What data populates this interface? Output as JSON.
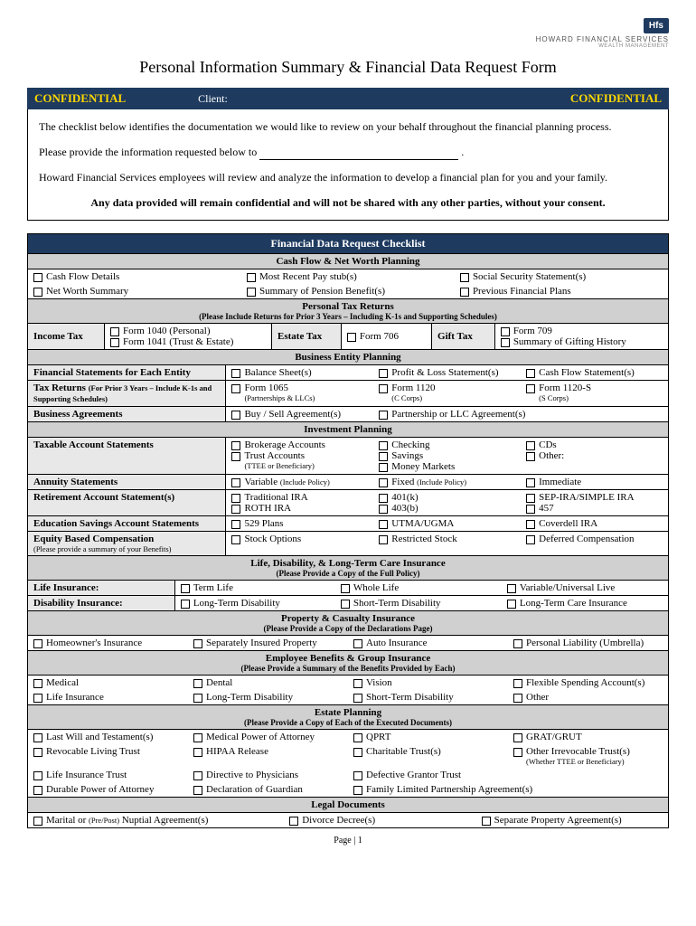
{
  "logo": {
    "badge": "Hfs",
    "company": "HOWARD FINANCIAL SERVICES",
    "tagline": "WEALTH MANAGEMENT"
  },
  "title": "Personal Information Summary & Financial Data Request Form",
  "conf": {
    "left": "CONFIDENTIAL",
    "client_label": "Client:",
    "right": "CONFIDENTIAL"
  },
  "intro": {
    "p1": "The checklist below identifies the documentation we would like to review on your behalf throughout the financial planning process.",
    "p2a": "Please provide the information requested below to",
    "p2b": ".",
    "p3": "Howard Financial Services employees will review and analyze the information to develop a financial plan for you and your family.",
    "p4": "Any data provided will remain confidential and will not be shared with any other parties, without your consent."
  },
  "checklist_title": "Financial Data Request Checklist",
  "sections": {
    "cashflow": {
      "header": "Cash Flow & Net Worth Planning",
      "r1": [
        "Cash Flow Details",
        "Most Recent Pay stub(s)",
        "Social Security Statement(s)"
      ],
      "r2": [
        "Net Worth Summary",
        "Summary of Pension Benefit(s)",
        "Previous Financial Plans"
      ]
    },
    "tax": {
      "header": "Personal Tax Returns",
      "sub": "(Please Include Returns for Prior 3 Years – Including K-1s and Supporting Schedules)",
      "income_label": "Income Tax",
      "income": [
        "Form 1040 (Personal)",
        "Form 1041 (Trust & Estate)"
      ],
      "estate_label": "Estate Tax",
      "estate": "Form 706",
      "gift_label": "Gift Tax",
      "gift": [
        "Form 709",
        "Summary of Gifting History"
      ]
    },
    "business": {
      "header": "Business Entity Planning",
      "r1_label": "Financial Statements for Each Entity",
      "r1": [
        "Balance Sheet(s)",
        "Profit & Loss Statement(s)",
        "Cash Flow Statement(s)"
      ],
      "r2_label": "Tax Returns",
      "r2_note": "(For Prior 3 Years – Include K-1s and Supporting Schedules)",
      "r2a": "Form 1065",
      "r2a_note": "(Partnerships & LLCs)",
      "r2b": "Form 1120",
      "r2b_note": "(C Corps)",
      "r2c": "Form 1120-S",
      "r2c_note": "(S Corps)",
      "r3_label": "Business Agreements",
      "r3": [
        "Buy / Sell Agreement(s)",
        "Partnership or LLC Agreement(s)"
      ]
    },
    "invest": {
      "header": "Investment Planning",
      "r1_label": "Taxable Account Statements",
      "r1c1": [
        "Brokerage Accounts",
        "Trust Accounts"
      ],
      "r1c1_note": "(TTEE or Beneficiary)",
      "r1c2": [
        "Checking",
        "Savings",
        "Money Markets"
      ],
      "r1c3": [
        "CDs",
        "Other:"
      ],
      "r2_label": "Annuity Statements",
      "r2": [
        "Variable",
        "Fixed",
        "Immediate"
      ],
      "r2_note": "(Include Policy)",
      "r3_label": "Retirement Account Statement(s)",
      "r3c1": [
        "Traditional IRA",
        "ROTH IRA"
      ],
      "r3c2": [
        "401(k)",
        "403(b)"
      ],
      "r3c3": [
        "SEP-IRA/SIMPLE IRA",
        "457"
      ],
      "r4_label": "Education Savings Account Statements",
      "r4": [
        "529 Plans",
        "UTMA/UGMA",
        "Coverdell IRA"
      ],
      "r5_label": "Equity Based Compensation",
      "r5_note": "(Please provide a summary of your Benefits)",
      "r5": [
        "Stock Options",
        "Restricted Stock",
        "Deferred Compensation"
      ]
    },
    "life": {
      "header": "Life, Disability, & Long-Term Care Insurance",
      "sub": "(Please Provide a Copy of the Full Policy)",
      "r1_label": "Life Insurance:",
      "r1": [
        "Term Life",
        "Whole Life",
        "Variable/Universal Live"
      ],
      "r2_label": "Disability Insurance:",
      "r2": [
        "Long-Term Disability",
        "Short-Term Disability",
        "Long-Term Care Insurance"
      ]
    },
    "property": {
      "header": "Property & Casualty Insurance",
      "sub": "(Please Provide a Copy of the Declarations Page)",
      "r1": [
        "Homeowner's Insurance",
        "Separately Insured Property",
        "Auto Insurance",
        "Personal Liability (Umbrella)"
      ]
    },
    "employee": {
      "header": "Employee Benefits & Group Insurance",
      "sub": "(Please Provide a Summary of the Benefits Provided by Each)",
      "r1": [
        "Medical",
        "Dental",
        "Vision",
        "Flexible Spending Account(s)"
      ],
      "r2": [
        "Life Insurance",
        "Long-Term Disability",
        "Short-Term Disability",
        "Other"
      ]
    },
    "estate": {
      "header": "Estate Planning",
      "sub": "(Please Provide a Copy of Each of the Executed Documents)",
      "r1": [
        "Last Will and Testament(s)",
        "Medical Power of Attorney",
        "QPRT",
        "GRAT/GRUT"
      ],
      "r2": [
        "Revocable Living Trust",
        "HIPAA Release",
        "Charitable Trust(s)",
        "Other Irrevocable Trust(s)"
      ],
      "r2_note": "(Whether TTEE or Beneficiary)",
      "r3": [
        "Life Insurance Trust",
        "Directive to Physicians",
        "Defective Grantor Trust",
        ""
      ],
      "r4": [
        "Durable Power of Attorney",
        "Declaration of Guardian",
        "Family Limited Partnership Agreement(s)",
        ""
      ]
    },
    "legal": {
      "header": "Legal Documents",
      "r1a": "Marital or",
      "r1a_note": "(Pre/Post)",
      "r1a2": "Nuptial Agreement(s)",
      "r1": [
        "Divorce Decree(s)",
        "Separate Property Agreement(s)"
      ]
    }
  },
  "footer": "Page | 1"
}
